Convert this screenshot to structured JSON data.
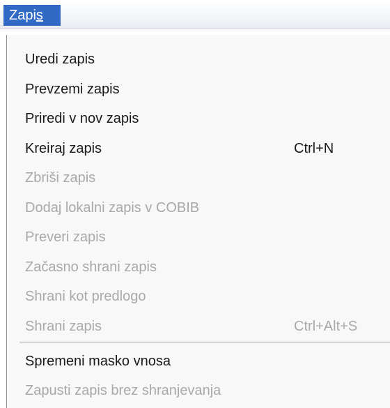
{
  "menu": {
    "title_prefix": "Zapi",
    "title_mnemonic": "s"
  },
  "items": [
    {
      "label": "Uredi zapis",
      "shortcut": "",
      "enabled": true
    },
    {
      "label": "Prevzemi zapis",
      "shortcut": "",
      "enabled": true
    },
    {
      "label": "Priredi v nov zapis",
      "shortcut": "",
      "enabled": true
    },
    {
      "label": "Kreiraj zapis",
      "shortcut": "Ctrl+N",
      "enabled": true
    },
    {
      "label": "Zbriši zapis",
      "shortcut": "",
      "enabled": false
    },
    {
      "label": "Dodaj lokalni zapis v COBIB",
      "shortcut": "",
      "enabled": false
    },
    {
      "label": "Preveri zapis",
      "shortcut": "",
      "enabled": false
    },
    {
      "label": "Začasno shrani zapis",
      "shortcut": "",
      "enabled": false
    },
    {
      "label": "Shrani kot predlogo",
      "shortcut": "",
      "enabled": false
    },
    {
      "label": "Shrani zapis",
      "shortcut": "Ctrl+Alt+S",
      "enabled": false
    },
    {
      "label": "Spremeni masko vnosa",
      "shortcut": "",
      "enabled": true
    },
    {
      "label": "Zapusti zapis brez shranjevanja",
      "shortcut": "",
      "enabled": false
    }
  ],
  "colors": {
    "menu_title_bg": "#316ac5",
    "enabled_text": "#1a1a1a",
    "disabled_text": "#a9a9a9",
    "dropdown_bg": "#f8f8f8"
  }
}
